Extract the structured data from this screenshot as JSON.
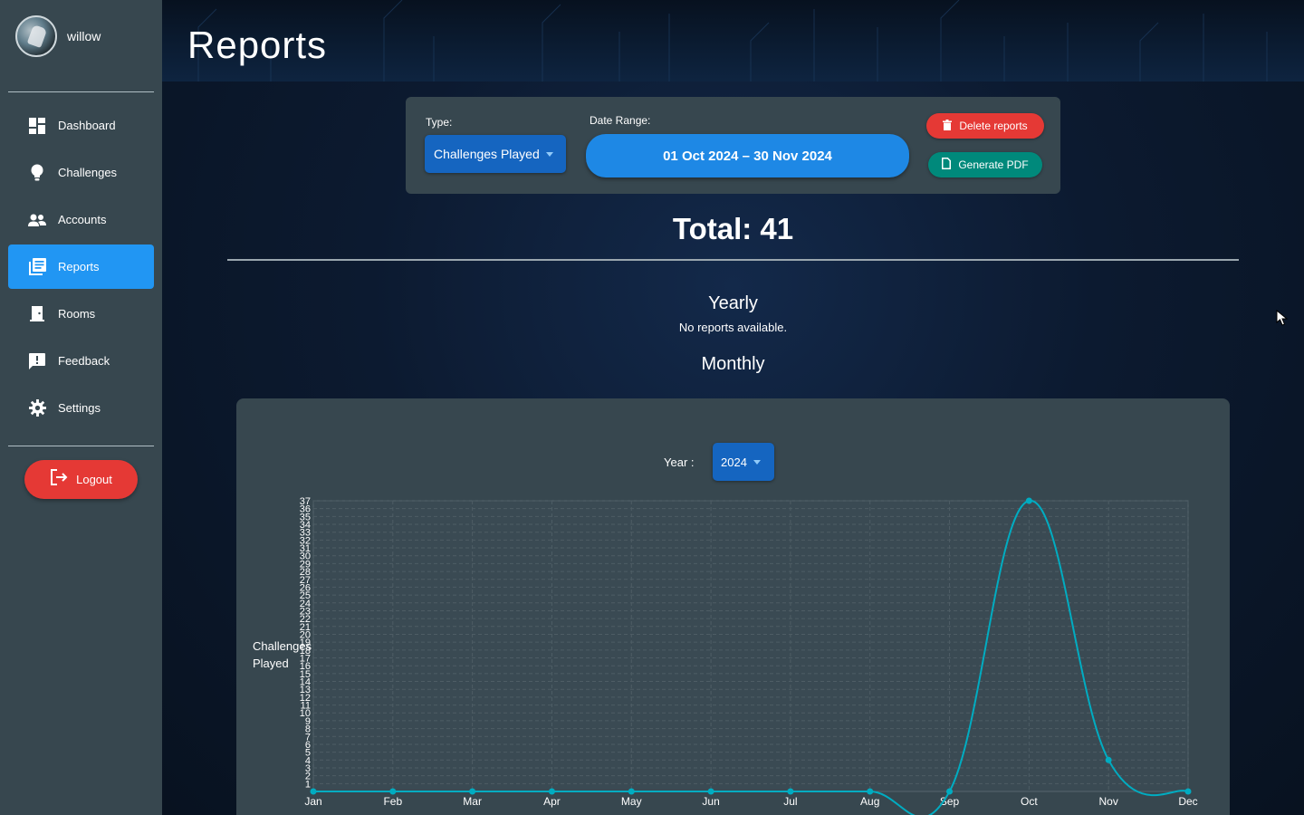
{
  "user": {
    "name": "willow"
  },
  "nav": [
    {
      "label": "Dashboard",
      "icon": "dashboard-icon",
      "active": false
    },
    {
      "label": "Challenges",
      "icon": "lightbulb-icon",
      "active": false
    },
    {
      "label": "Accounts",
      "icon": "people-icon",
      "active": false
    },
    {
      "label": "Reports",
      "icon": "reports-icon",
      "active": true
    },
    {
      "label": "Rooms",
      "icon": "door-icon",
      "active": false
    },
    {
      "label": "Feedback",
      "icon": "feedback-icon",
      "active": false
    },
    {
      "label": "Settings",
      "icon": "gear-icon",
      "active": false
    }
  ],
  "logout_label": "Logout",
  "page_title": "Reports",
  "filters": {
    "type_label": "Type:",
    "type_value": "Challenges Played",
    "date_label": "Date Range:",
    "date_value": "01 Oct 2024 – 30 Nov 2024",
    "delete_label": "Delete reports",
    "pdf_label": "Generate PDF"
  },
  "total": "Total: 41",
  "yearly": {
    "title": "Yearly",
    "message": "No reports available."
  },
  "monthly": {
    "title": "Monthly",
    "year_label": "Year :",
    "year_value": "2024"
  },
  "colors": {
    "sidebar": "#37474f",
    "active": "#2196f3",
    "danger": "#e53935",
    "teal": "#00897b",
    "line": "#00acc1"
  },
  "chart_data": {
    "type": "line",
    "categories": [
      "Jan",
      "Feb",
      "Mar",
      "Apr",
      "May",
      "Jun",
      "Jul",
      "Aug",
      "Sep",
      "Oct",
      "Nov",
      "Dec"
    ],
    "series": [
      {
        "values": [
          0,
          0,
          0,
          0,
          0,
          0,
          0,
          0,
          0,
          37,
          4,
          0
        ]
      }
    ],
    "ylabel": "Challenges Played",
    "xlabel": "",
    "ylim": [
      0,
      37
    ],
    "yticks": [
      1,
      2,
      3,
      4,
      5,
      6,
      7,
      8,
      9,
      10,
      11,
      12,
      13,
      14,
      15,
      16,
      17,
      18,
      19,
      20,
      21,
      22,
      23,
      24,
      25,
      26,
      27,
      28,
      29,
      30,
      31,
      32,
      33,
      34,
      35,
      36,
      37
    ],
    "grid": true,
    "smooth": true
  }
}
